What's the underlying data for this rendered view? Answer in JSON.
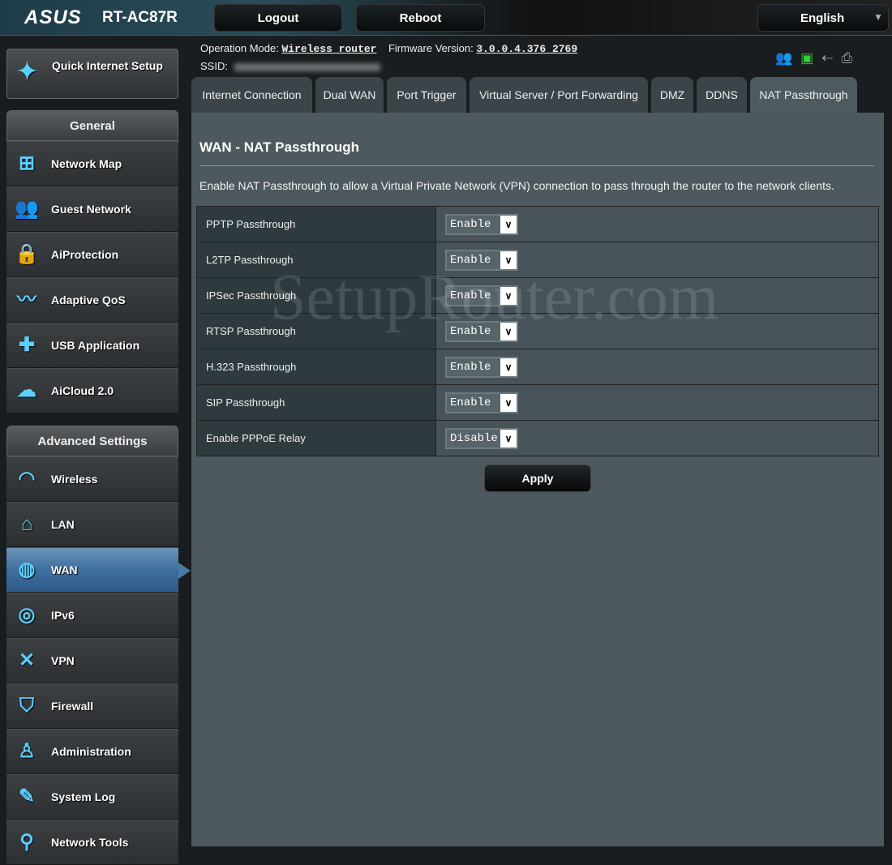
{
  "header": {
    "logo": "ASUS",
    "model": "RT-AC87R",
    "logout": "Logout",
    "reboot": "Reboot",
    "language": "English"
  },
  "info": {
    "op_mode_label": "Operation Mode:",
    "op_mode": "Wireless router",
    "fw_label": "Firmware Version:",
    "fw": "3.0.0.4.376_2769",
    "ssid_label": "SSID:"
  },
  "status_icons": [
    "clients-icon",
    "network-icon",
    "usb-icon",
    "printer-icon"
  ],
  "quick_setup": "Quick Internet Setup",
  "sidebar": {
    "general_title": "General",
    "general": [
      {
        "label": "Network Map",
        "icon": "network-map-icon"
      },
      {
        "label": "Guest Network",
        "icon": "guest-network-icon"
      },
      {
        "label": "AiProtection",
        "icon": "lock-icon"
      },
      {
        "label": "Adaptive QoS",
        "icon": "qos-icon"
      },
      {
        "label": "USB Application",
        "icon": "puzzle-icon"
      },
      {
        "label": "AiCloud 2.0",
        "icon": "cloud-icon"
      }
    ],
    "advanced_title": "Advanced Settings",
    "advanced": [
      {
        "label": "Wireless",
        "icon": "wifi-icon"
      },
      {
        "label": "LAN",
        "icon": "home-icon"
      },
      {
        "label": "WAN",
        "icon": "globe-icon"
      },
      {
        "label": "IPv6",
        "icon": "ipv6-icon"
      },
      {
        "label": "VPN",
        "icon": "vpn-icon"
      },
      {
        "label": "Firewall",
        "icon": "shield-icon"
      },
      {
        "label": "Administration",
        "icon": "user-icon"
      },
      {
        "label": "System Log",
        "icon": "log-icon"
      },
      {
        "label": "Network Tools",
        "icon": "tools-icon"
      }
    ]
  },
  "tabs": [
    "Internet Connection",
    "Dual WAN",
    "Port Trigger",
    "Virtual Server / Port Forwarding",
    "DMZ",
    "DDNS",
    "NAT Passthrough"
  ],
  "main": {
    "title": "WAN - NAT Passthrough",
    "description": "Enable NAT Passthrough to allow a Virtual Private Network (VPN) connection to pass through the router to the network clients.",
    "apply": "Apply",
    "rows": [
      {
        "label": "PPTP Passthrough",
        "value": "Enable"
      },
      {
        "label": "L2TP Passthrough",
        "value": "Enable"
      },
      {
        "label": "IPSec Passthrough",
        "value": "Enable"
      },
      {
        "label": "RTSP Passthrough",
        "value": "Enable"
      },
      {
        "label": "H.323 Passthrough",
        "value": "Enable"
      },
      {
        "label": "SIP Passthrough",
        "value": "Enable"
      },
      {
        "label": "Enable PPPoE Relay",
        "value": "Disable"
      }
    ]
  },
  "watermark": "SetupRouter.com",
  "colors": {
    "active_item": "#3e6f9e",
    "accent_icon": "#5bd0ff",
    "panel": "#4d595e"
  }
}
